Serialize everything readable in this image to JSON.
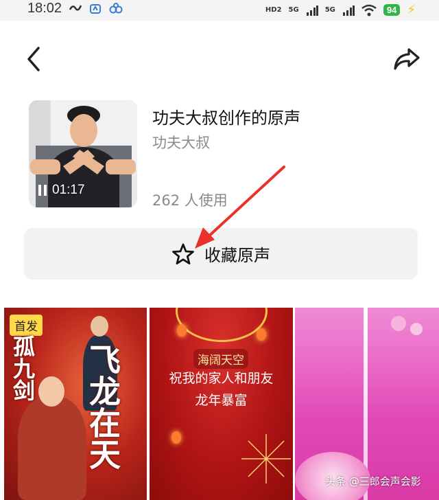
{
  "status_bar": {
    "time": "18:02",
    "net_hd": "HD2",
    "sig1": "5G",
    "sig2": "5G",
    "battery": "94"
  },
  "music": {
    "title": "功夫大叔创作的原声",
    "author": "功夫大叔",
    "usage": "262 人使用",
    "play_time": "01:17"
  },
  "actions": {
    "collect_label": "收藏原声"
  },
  "videos": [
    {
      "badge": "首发",
      "title_left": "孤九剑",
      "title_right": "飞龙在天"
    },
    {
      "plaque": "海阔天空",
      "line1": "祝我的家人和朋友",
      "line2": "龙年暴富"
    },
    {}
  ],
  "watermark": "头条 @三郎会声会影",
  "colors": {
    "arrow": "#e8322a",
    "battery": "#2fb54a",
    "badge": "#ffd94a"
  }
}
